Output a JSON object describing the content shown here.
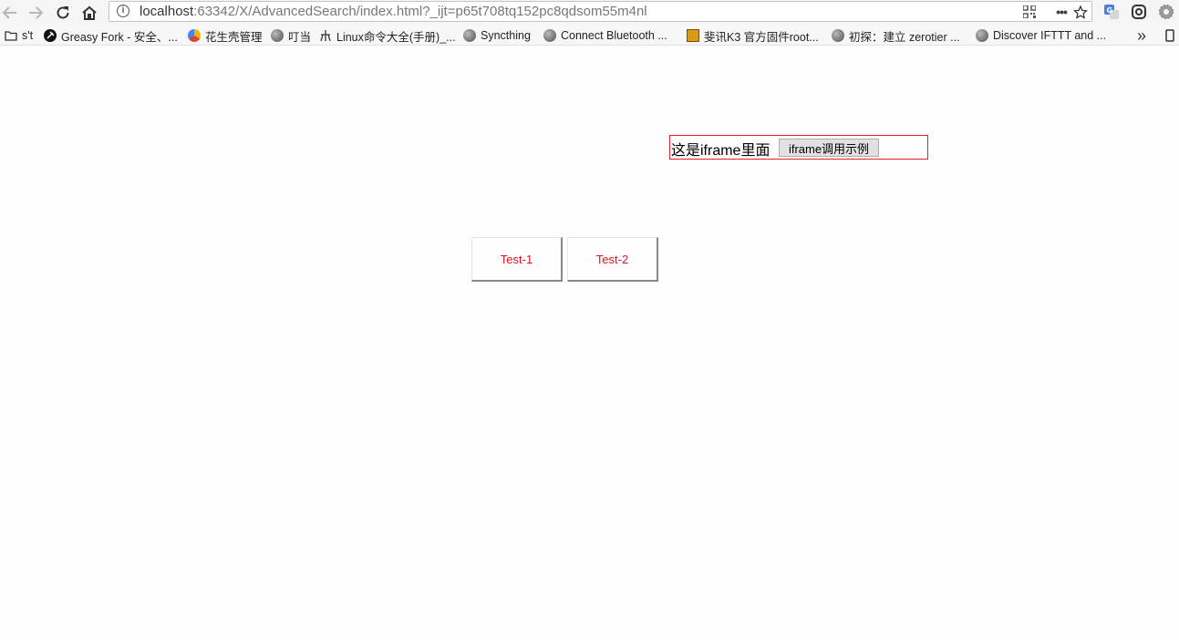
{
  "browser": {
    "url_host": "localhost",
    "url_path": ":63342/X/AdvancedSearch/index.html?_ijt=p65t708tq152pc8qdsom55m4nl",
    "menu_glyph": "•••",
    "overflow_glyph": "»"
  },
  "bookmarks": {
    "items": [
      {
        "label": "s't",
        "icon": "folder-icon"
      },
      {
        "label": "Greasy Fork - 安全、...",
        "icon": "greasyfork-icon"
      },
      {
        "label": "花生壳管理",
        "icon": "oray-icon"
      },
      {
        "label": "叮当",
        "icon": "globe-icon"
      },
      {
        "label": "Linux命令大全(手册)_...",
        "icon": "linux-icon"
      },
      {
        "label": "Syncthing",
        "icon": "globe-icon"
      },
      {
        "label": "Connect Bluetooth ...",
        "icon": "globe-icon"
      },
      {
        "label": "斐讯K3 官方固件root...",
        "icon": "k3-icon"
      },
      {
        "label": "初探：建立 zerotier ...",
        "icon": "globe-icon"
      },
      {
        "label": "Discover IFTTT and ...",
        "icon": "globe-icon"
      }
    ]
  },
  "page": {
    "iframe_label": "这是iframe里面",
    "iframe_button": "iframe调用示例",
    "test1": "Test-1",
    "test2": "Test-2",
    "accent": "#e0101a"
  }
}
